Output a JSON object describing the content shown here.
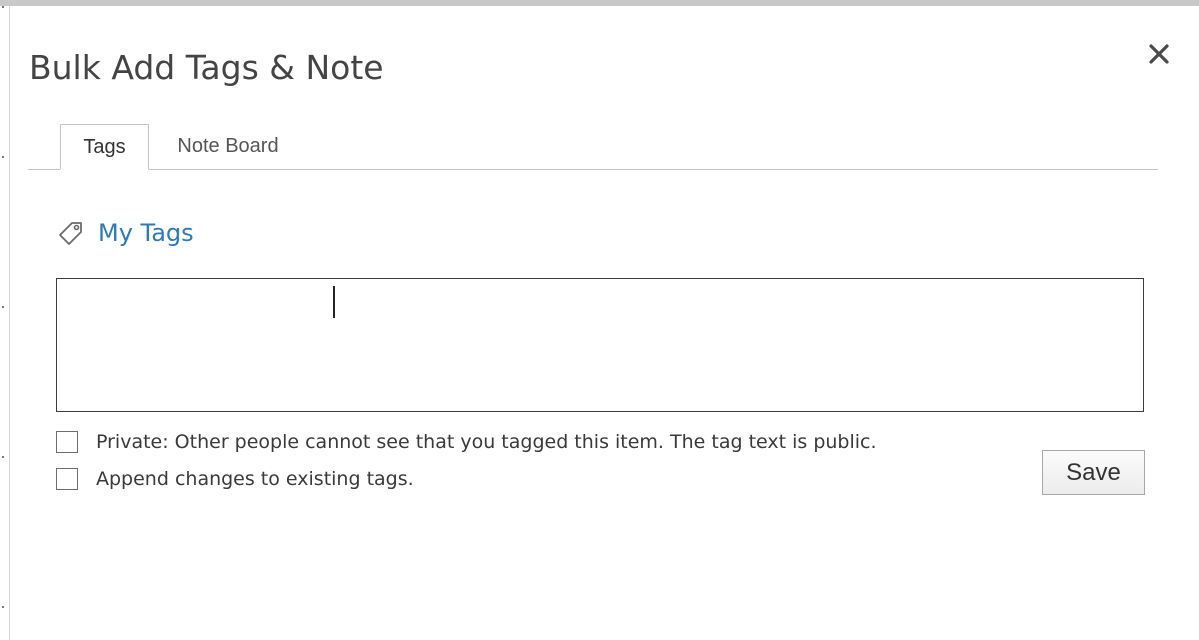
{
  "dialog": {
    "title": "Bulk Add Tags & Note",
    "close_icon": "close-icon"
  },
  "tabs": [
    {
      "label": "Tags",
      "selected": true
    },
    {
      "label": "Note Board",
      "selected": false
    }
  ],
  "tags_section": {
    "heading": "My Tags",
    "icon": "tag-icon",
    "heading_color": "#2a7ac0",
    "input_value": "",
    "options": [
      {
        "label": "Private: Other people cannot see that you tagged this item. The tag text is public.",
        "checked": false
      },
      {
        "label": "Append changes to existing tags.",
        "checked": false
      }
    ],
    "save_label": "Save"
  }
}
